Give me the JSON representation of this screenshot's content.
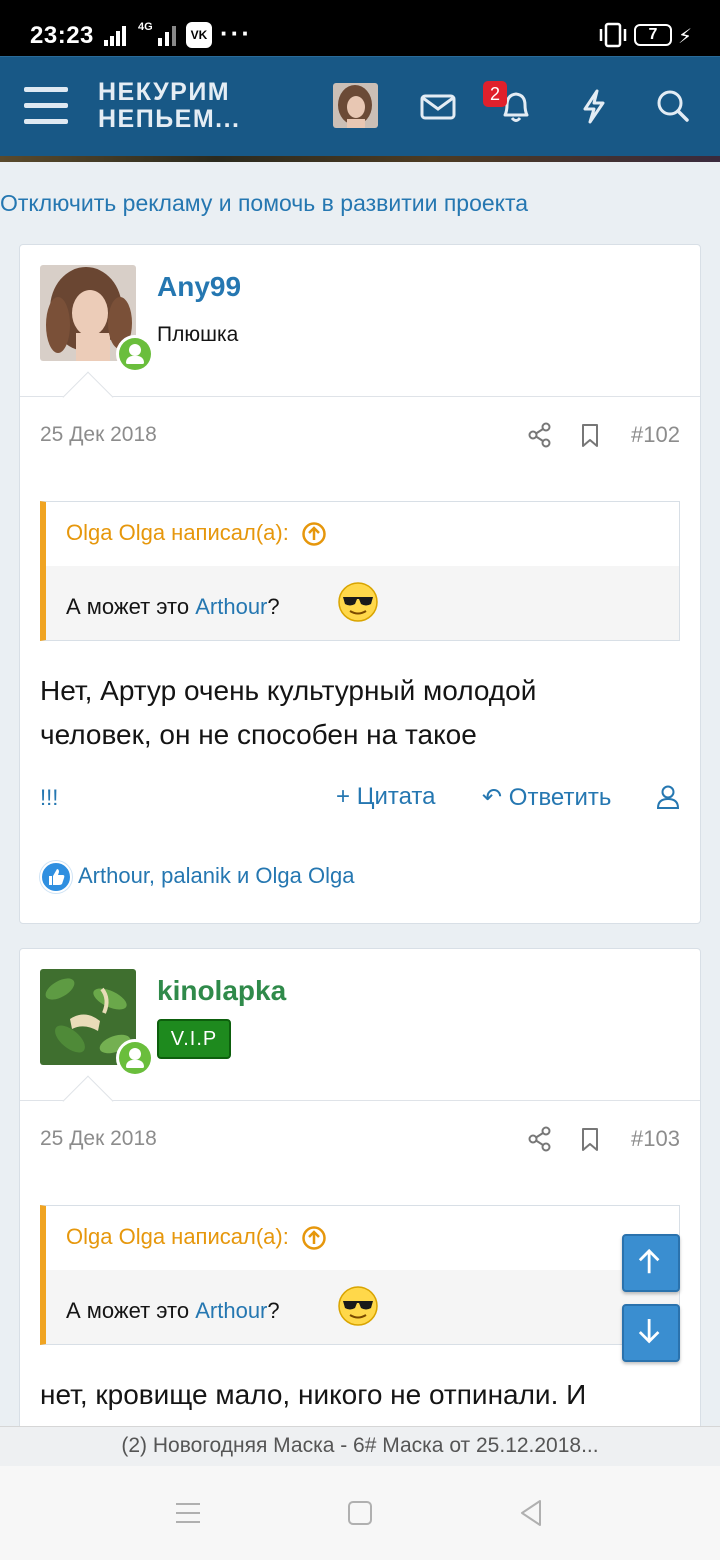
{
  "status_bar": {
    "time": "23:23",
    "network": "4G",
    "vk_icon": "VK",
    "more": "···",
    "battery": "7"
  },
  "header": {
    "logo_line1": "НЕКУРИМ",
    "logo_line2": "НЕПЬЕМ...",
    "notifications_count": "2",
    "icons": [
      "menu-icon",
      "avatar",
      "envelope-icon",
      "bell-icon",
      "lightning-icon",
      "search-icon"
    ]
  },
  "ad_link": "Отключить рекламу и помочь в развитии проекта",
  "posts": [
    {
      "username": "Any99",
      "user_title": "Плюшка",
      "username_color": "#2577b1",
      "date": "25 Дек 2018",
      "number": "#102",
      "quote_author": "Olga Olga написал(а):",
      "quote_text": "А может это ",
      "quote_link": "Arthour",
      "quote_after": "?",
      "text_line1": "Нет, Артур очень культурный молодой",
      "text_line2": "человек, он не способен на такое",
      "report": "!!!",
      "quote_action": "Цитата",
      "reply_action": "Ответить",
      "reactions": "Arthour, palanik и Olga Olga"
    },
    {
      "username": "kinolapka",
      "user_badge": "V.I.P",
      "username_color": "#2f8a4a",
      "date": "25 Дек 2018",
      "number": "#103",
      "quote_author": "Olga Olga написал(а):",
      "quote_text": "А может это ",
      "quote_link": "Arthour",
      "quote_after": "?",
      "text_line1": "нет, кровище мало, никого не отпинали. И"
    }
  ],
  "footer_title": "(2) Новогодняя Маска - 6# Маска от 25.12.2018...",
  "accent_color": "#185886",
  "quote_accent": "#f0a422"
}
